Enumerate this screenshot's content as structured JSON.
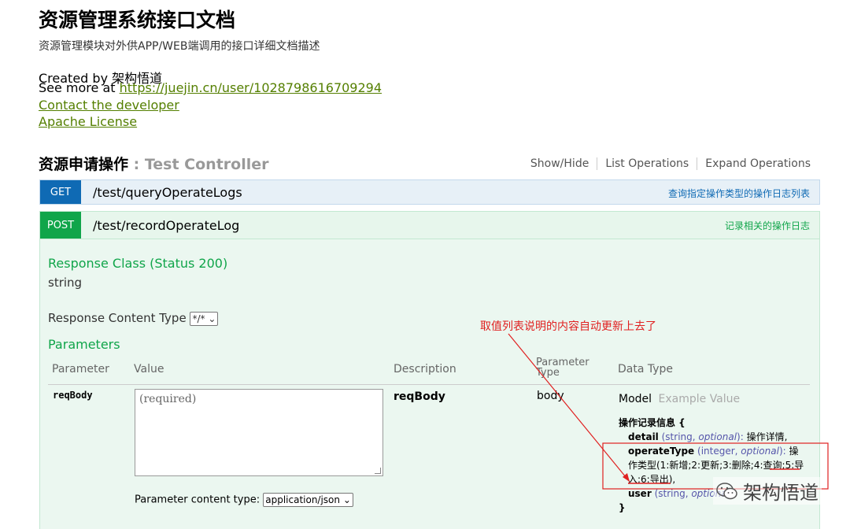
{
  "info": {
    "title": "资源管理系统接口文档",
    "description": "资源管理模块对外供APP/WEB端调用的接口详细文档描述",
    "created_by": "Created by 架构悟道",
    "see_more_prefix": "See more at ",
    "see_more_url": "https://juejin.cn/user/1028798616709294",
    "contact": "Contact the developer",
    "license": "Apache License"
  },
  "resource": {
    "title": "资源申请操作",
    "separator": " : ",
    "controller": "Test Controller",
    "actions": [
      "Show/Hide",
      "List Operations",
      "Expand Operations"
    ]
  },
  "operations": [
    {
      "method": "GET",
      "path": "/test/queryOperateLogs",
      "summary": "查询指定操作类型的操作日志列表",
      "color": "#0f6ab4"
    },
    {
      "method": "POST",
      "path": "/test/recordOperateLog",
      "summary": "记录相关的操作日志",
      "color": "#10a54a"
    }
  ],
  "post_detail": {
    "response_class_heading": "Response Class (Status 200)",
    "response_class_type": "string",
    "response_content_type_label": "Response Content Type",
    "response_content_type_value": "*/*",
    "parameters_heading": "Parameters",
    "table_headers": {
      "parameter": "Parameter",
      "value": "Value",
      "description": "Description",
      "parameter_type_1": "Parameter",
      "parameter_type_2": "Type",
      "data_type": "Data Type"
    },
    "param": {
      "name": "reqBody",
      "placeholder": "(required)",
      "description": "reqBody",
      "type": "body",
      "content_type_label": "Parameter content type:",
      "content_type_value": "application/json"
    },
    "model_tabs": {
      "model": "Model",
      "example": "Example Value"
    },
    "model": {
      "header": "操作记录信息 {",
      "fields": [
        {
          "name": "detail",
          "type_open": " (",
          "type": "string",
          "sep": ", ",
          "opt": "optional",
          "type_close": "): ",
          "desc": "操作详情,"
        },
        {
          "name": "operateType",
          "type_open": " (",
          "type": "integer",
          "sep": ", ",
          "opt": "optional",
          "type_close": "): ",
          "desc": "操作类型(1:新增;2:更新;3:删除;4:查询;5:导入;6:导出),"
        },
        {
          "name": "user",
          "type_open": " (",
          "type": "string",
          "sep": ", ",
          "opt": "optional",
          "type_close": "): ",
          "desc": ""
        }
      ],
      "footer": "}"
    }
  },
  "annotation": {
    "text": "取值列表说明的内容自动更新上去了",
    "color": "#e02020"
  },
  "watermark": "架构悟道"
}
